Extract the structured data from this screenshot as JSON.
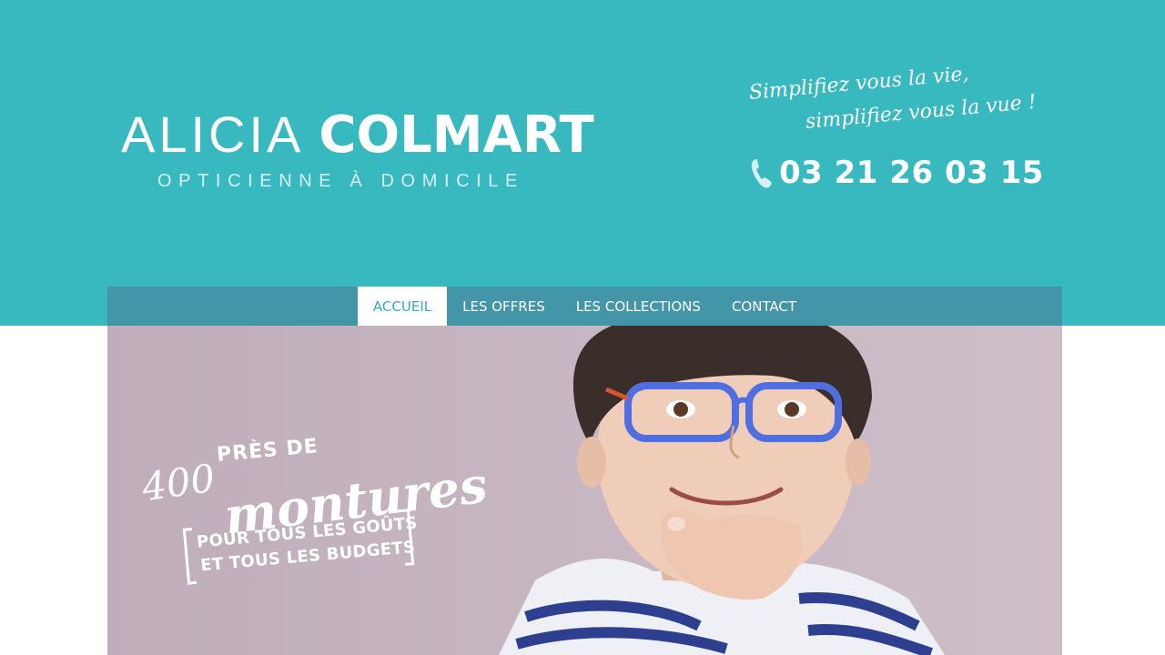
{
  "brand": {
    "first_name": "ALICIA",
    "last_name": "COLMART",
    "subtitle": "OPTICIENNE À DOMICILE"
  },
  "header": {
    "tagline_line1": "Simplifiez vous  la vie,",
    "tagline_line2": "simplifiez vous la vue !",
    "phone": "03 21 26 03 15",
    "phone_icon": "phone-icon"
  },
  "nav": {
    "items": [
      {
        "label": "ACCUEIL",
        "active": true
      },
      {
        "label": "LES OFFRES",
        "active": false
      },
      {
        "label": "LES COLLECTIONS",
        "active": false
      },
      {
        "label": "CONTACT",
        "active": false
      }
    ]
  },
  "hero": {
    "line_pres": "PRÈS DE",
    "line_number": "400",
    "line_montures": "montures",
    "box_line1": "POUR TOUS LES GOÛTS",
    "box_line2": "ET TOUS LES BUDGETS"
  },
  "colors": {
    "header_bg": "#38b9c0",
    "nav_bg": "#4296a8",
    "nav_active_text": "#3aa7b5",
    "hero_bg": "#c6b6c1",
    "glasses": "#4f6fe0"
  }
}
